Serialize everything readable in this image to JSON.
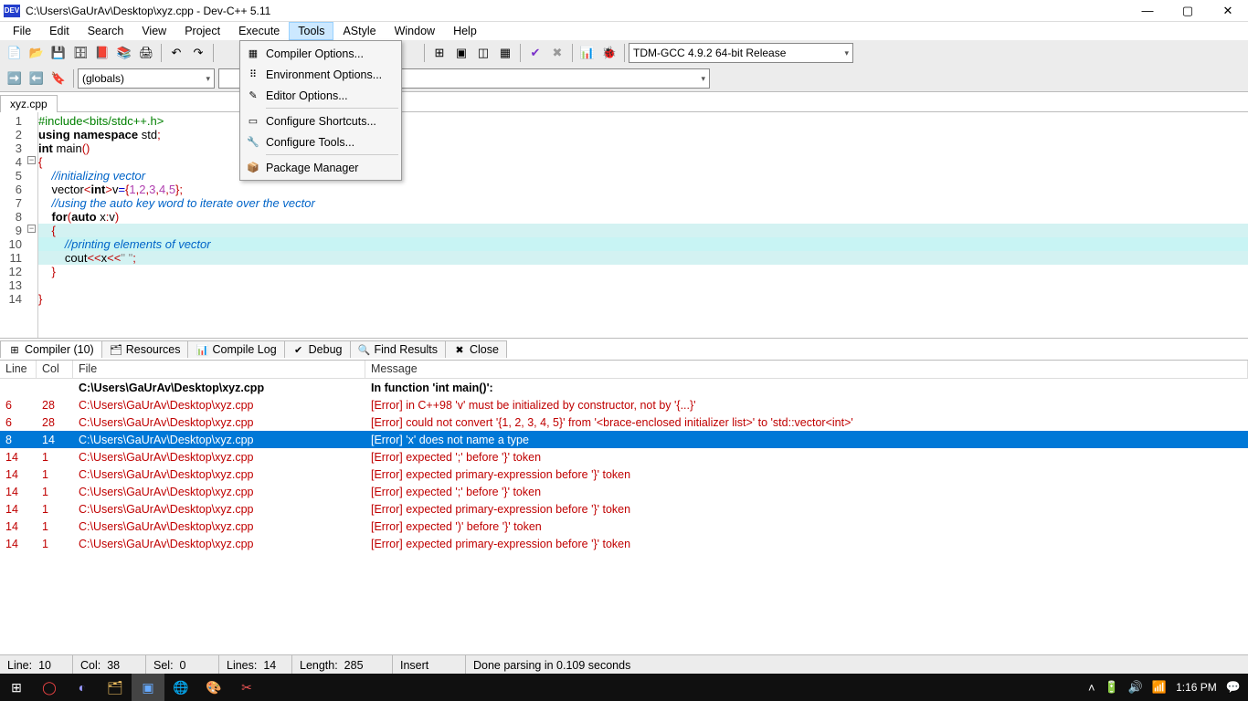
{
  "titlebar": {
    "icon_text": "DEV",
    "title": "C:\\Users\\GaUrAv\\Desktop\\xyz.cpp - Dev-C++ 5.11"
  },
  "menubar": {
    "items": [
      "File",
      "Edit",
      "Search",
      "View",
      "Project",
      "Execute",
      "Tools",
      "AStyle",
      "Window",
      "Help"
    ],
    "open_index": 6
  },
  "tools_menu": {
    "items": [
      {
        "label": "Compiler Options...",
        "icon": "▦"
      },
      {
        "label": "Environment Options...",
        "icon": "⠿"
      },
      {
        "label": "Editor Options...",
        "icon": "✎"
      },
      {
        "label": "Configure Shortcuts...",
        "icon": "▭",
        "sep_before": true
      },
      {
        "label": "Configure Tools...",
        "icon": "🔧"
      },
      {
        "label": "Package Manager",
        "icon": "📦",
        "sep_before": true
      }
    ]
  },
  "toolbar": {
    "combo_globals": "(globals)",
    "compiler_select": "TDM-GCC 4.9.2 64-bit Release"
  },
  "filetab": {
    "name": "xyz.cpp"
  },
  "code": {
    "lines": [
      {
        "n": 1,
        "html": "<span class='pp'>#include&lt;bits/stdc++.h&gt;</span>"
      },
      {
        "n": 2,
        "html": "<span class='kw'>using</span> <span class='kw'>namespace</span> std<span class='red'>;</span>"
      },
      {
        "n": 3,
        "html": "<span class='kw'>int</span> main<span class='red'>()</span>"
      },
      {
        "n": 4,
        "html": "<span class='red'>{</span>"
      },
      {
        "n": 5,
        "html": "    <span class='cm'>//initializing vector</span>"
      },
      {
        "n": 6,
        "html": "    vector<span class='red'>&lt;</span><span class='kw'>int</span><span class='red'>&gt;</span>v<span class='blue'>=</span><span class='red'>{</span><span class='num'>1</span><span class='red'>,</span><span class='num'>2</span><span class='red'>,</span><span class='num'>3</span><span class='red'>,</span><span class='num'>4</span><span class='red'>,</span><span class='num'>5</span><span class='red'>};</span>"
      },
      {
        "n": 7,
        "html": "    <span class='cm'>//using the auto key word to iterate over the vector</span>"
      },
      {
        "n": 8,
        "html": "    <span class='kw'>for</span><span class='red'>(</span><span class='kw'>auto</span> x<span class='red'>:</span>v<span class='red'>)</span>"
      },
      {
        "n": 9,
        "html": "    <span class='red'>{</span>",
        "hl": true
      },
      {
        "n": 10,
        "html": "        <span class='cm'>//printing elements of vector</span>",
        "cur": true
      },
      {
        "n": 11,
        "html": "        cout<span class='red'>&lt;&lt;</span>x<span class='red'>&lt;&lt;</span><span class='str'>\" \"</span><span class='red'>;</span>",
        "hl": true
      },
      {
        "n": 12,
        "html": "    <span class='red'>}</span>"
      },
      {
        "n": 13,
        "html": ""
      },
      {
        "n": 14,
        "html": "<span class='red'>}</span>"
      }
    ]
  },
  "bottom_tabs": [
    {
      "label": "Compiler (10)",
      "icon": "⊞",
      "active": true
    },
    {
      "label": "Resources",
      "icon": "🗂"
    },
    {
      "label": "Compile Log",
      "icon": "📊"
    },
    {
      "label": "Debug",
      "icon": "✔"
    },
    {
      "label": "Find Results",
      "icon": "🔍"
    },
    {
      "label": "Close",
      "icon": "✖"
    }
  ],
  "errors": {
    "headers": {
      "line": "Line",
      "col": "Col",
      "file": "File",
      "msg": "Message"
    },
    "header_row": {
      "file": "C:\\Users\\GaUrAv\\Desktop\\xyz.cpp",
      "msg": "In function 'int main()':"
    },
    "rows": [
      {
        "line": "6",
        "col": "28",
        "file": "C:\\Users\\GaUrAv\\Desktop\\xyz.cpp",
        "msg": "[Error] in C++98 'v' must be initialized by constructor, not by '{...}'",
        "cls": "err"
      },
      {
        "line": "6",
        "col": "28",
        "file": "C:\\Users\\GaUrAv\\Desktop\\xyz.cpp",
        "msg": "[Error] could not convert '{1, 2, 3, 4, 5}' from '<brace-enclosed initializer list>' to 'std::vector<int>'",
        "cls": "err"
      },
      {
        "line": "8",
        "col": "14",
        "file": "C:\\Users\\GaUrAv\\Desktop\\xyz.cpp",
        "msg": "[Error] 'x' does not name a type",
        "cls": "sel"
      },
      {
        "line": "14",
        "col": "1",
        "file": "C:\\Users\\GaUrAv\\Desktop\\xyz.cpp",
        "msg": "[Error] expected ';' before '}' token",
        "cls": "err"
      },
      {
        "line": "14",
        "col": "1",
        "file": "C:\\Users\\GaUrAv\\Desktop\\xyz.cpp",
        "msg": "[Error] expected primary-expression before '}' token",
        "cls": "err"
      },
      {
        "line": "14",
        "col": "1",
        "file": "C:\\Users\\GaUrAv\\Desktop\\xyz.cpp",
        "msg": "[Error] expected ';' before '}' token",
        "cls": "err"
      },
      {
        "line": "14",
        "col": "1",
        "file": "C:\\Users\\GaUrAv\\Desktop\\xyz.cpp",
        "msg": "[Error] expected primary-expression before '}' token",
        "cls": "err"
      },
      {
        "line": "14",
        "col": "1",
        "file": "C:\\Users\\GaUrAv\\Desktop\\xyz.cpp",
        "msg": "[Error] expected ')' before '}' token",
        "cls": "err"
      },
      {
        "line": "14",
        "col": "1",
        "file": "C:\\Users\\GaUrAv\\Desktop\\xyz.cpp",
        "msg": "[Error] expected primary-expression before '}' token",
        "cls": "err"
      }
    ]
  },
  "status": {
    "line_lbl": "Line:",
    "line": "10",
    "col_lbl": "Col:",
    "col": "38",
    "sel_lbl": "Sel:",
    "sel": "0",
    "lines_lbl": "Lines:",
    "lines": "14",
    "len_lbl": "Length:",
    "len": "285",
    "mode": "Insert",
    "parse": "Done parsing in 0.109 seconds"
  },
  "taskbar": {
    "time": "1:16 PM"
  }
}
